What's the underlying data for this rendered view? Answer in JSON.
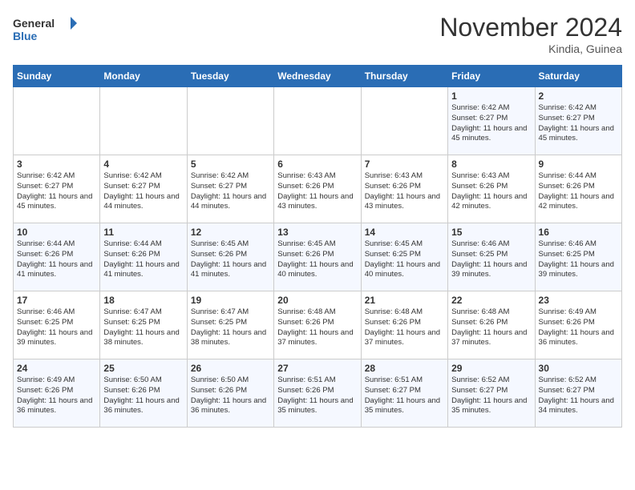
{
  "logo": {
    "line1": "General",
    "line2": "Blue"
  },
  "title": "November 2024",
  "subtitle": "Kindia, Guinea",
  "days_of_week": [
    "Sunday",
    "Monday",
    "Tuesday",
    "Wednesday",
    "Thursday",
    "Friday",
    "Saturday"
  ],
  "weeks": [
    [
      {
        "day": "",
        "info": ""
      },
      {
        "day": "",
        "info": ""
      },
      {
        "day": "",
        "info": ""
      },
      {
        "day": "",
        "info": ""
      },
      {
        "day": "",
        "info": ""
      },
      {
        "day": "1",
        "info": "Sunrise: 6:42 AM\nSunset: 6:27 PM\nDaylight: 11 hours and 45 minutes."
      },
      {
        "day": "2",
        "info": "Sunrise: 6:42 AM\nSunset: 6:27 PM\nDaylight: 11 hours and 45 minutes."
      }
    ],
    [
      {
        "day": "3",
        "info": "Sunrise: 6:42 AM\nSunset: 6:27 PM\nDaylight: 11 hours and 45 minutes."
      },
      {
        "day": "4",
        "info": "Sunrise: 6:42 AM\nSunset: 6:27 PM\nDaylight: 11 hours and 44 minutes."
      },
      {
        "day": "5",
        "info": "Sunrise: 6:42 AM\nSunset: 6:27 PM\nDaylight: 11 hours and 44 minutes."
      },
      {
        "day": "6",
        "info": "Sunrise: 6:43 AM\nSunset: 6:26 PM\nDaylight: 11 hours and 43 minutes."
      },
      {
        "day": "7",
        "info": "Sunrise: 6:43 AM\nSunset: 6:26 PM\nDaylight: 11 hours and 43 minutes."
      },
      {
        "day": "8",
        "info": "Sunrise: 6:43 AM\nSunset: 6:26 PM\nDaylight: 11 hours and 42 minutes."
      },
      {
        "day": "9",
        "info": "Sunrise: 6:44 AM\nSunset: 6:26 PM\nDaylight: 11 hours and 42 minutes."
      }
    ],
    [
      {
        "day": "10",
        "info": "Sunrise: 6:44 AM\nSunset: 6:26 PM\nDaylight: 11 hours and 41 minutes."
      },
      {
        "day": "11",
        "info": "Sunrise: 6:44 AM\nSunset: 6:26 PM\nDaylight: 11 hours and 41 minutes."
      },
      {
        "day": "12",
        "info": "Sunrise: 6:45 AM\nSunset: 6:26 PM\nDaylight: 11 hours and 41 minutes."
      },
      {
        "day": "13",
        "info": "Sunrise: 6:45 AM\nSunset: 6:26 PM\nDaylight: 11 hours and 40 minutes."
      },
      {
        "day": "14",
        "info": "Sunrise: 6:45 AM\nSunset: 6:25 PM\nDaylight: 11 hours and 40 minutes."
      },
      {
        "day": "15",
        "info": "Sunrise: 6:46 AM\nSunset: 6:25 PM\nDaylight: 11 hours and 39 minutes."
      },
      {
        "day": "16",
        "info": "Sunrise: 6:46 AM\nSunset: 6:25 PM\nDaylight: 11 hours and 39 minutes."
      }
    ],
    [
      {
        "day": "17",
        "info": "Sunrise: 6:46 AM\nSunset: 6:25 PM\nDaylight: 11 hours and 39 minutes."
      },
      {
        "day": "18",
        "info": "Sunrise: 6:47 AM\nSunset: 6:25 PM\nDaylight: 11 hours and 38 minutes."
      },
      {
        "day": "19",
        "info": "Sunrise: 6:47 AM\nSunset: 6:25 PM\nDaylight: 11 hours and 38 minutes."
      },
      {
        "day": "20",
        "info": "Sunrise: 6:48 AM\nSunset: 6:26 PM\nDaylight: 11 hours and 37 minutes."
      },
      {
        "day": "21",
        "info": "Sunrise: 6:48 AM\nSunset: 6:26 PM\nDaylight: 11 hours and 37 minutes."
      },
      {
        "day": "22",
        "info": "Sunrise: 6:48 AM\nSunset: 6:26 PM\nDaylight: 11 hours and 37 minutes."
      },
      {
        "day": "23",
        "info": "Sunrise: 6:49 AM\nSunset: 6:26 PM\nDaylight: 11 hours and 36 minutes."
      }
    ],
    [
      {
        "day": "24",
        "info": "Sunrise: 6:49 AM\nSunset: 6:26 PM\nDaylight: 11 hours and 36 minutes."
      },
      {
        "day": "25",
        "info": "Sunrise: 6:50 AM\nSunset: 6:26 PM\nDaylight: 11 hours and 36 minutes."
      },
      {
        "day": "26",
        "info": "Sunrise: 6:50 AM\nSunset: 6:26 PM\nDaylight: 11 hours and 36 minutes."
      },
      {
        "day": "27",
        "info": "Sunrise: 6:51 AM\nSunset: 6:26 PM\nDaylight: 11 hours and 35 minutes."
      },
      {
        "day": "28",
        "info": "Sunrise: 6:51 AM\nSunset: 6:27 PM\nDaylight: 11 hours and 35 minutes."
      },
      {
        "day": "29",
        "info": "Sunrise: 6:52 AM\nSunset: 6:27 PM\nDaylight: 11 hours and 35 minutes."
      },
      {
        "day": "30",
        "info": "Sunrise: 6:52 AM\nSunset: 6:27 PM\nDaylight: 11 hours and 34 minutes."
      }
    ]
  ]
}
